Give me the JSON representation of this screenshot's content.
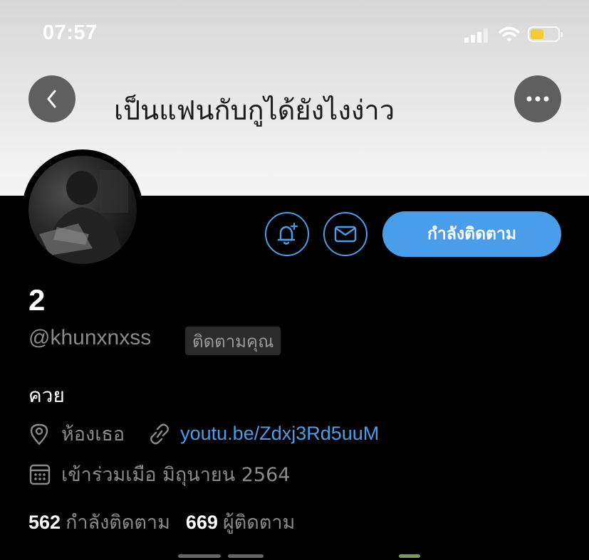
{
  "status_bar": {
    "time": "07:57",
    "battery_color": "#f4cc36"
  },
  "header": {
    "title": "เป็นแฟนกับกูได้ยังไงง่าว",
    "back_icon": "chevron-left-icon",
    "more_icon": "ellipsis-icon"
  },
  "profile": {
    "display_name": "2",
    "handle": "@khunxnxss",
    "follows_you_badge": "ติดตามคุณ",
    "bio": "ควย",
    "location": "ห้องเธอ",
    "link": "youtu.be/Zdxj3Rd5uuM",
    "joined": "เข้าร่วมเมือ มิถุนายน 2564",
    "following_count": "562",
    "following_label": "กำลังติดตาม",
    "followers_count": "669",
    "followers_label": "ผู้ติดตาม"
  },
  "actions": {
    "notify_icon": "bell-plus-icon",
    "message_icon": "envelope-icon",
    "following_button_label": "กำลังติดตาม"
  },
  "colors": {
    "accent": "#4a9ee9",
    "background": "#000000",
    "muted_text": "#8a8a8a"
  }
}
